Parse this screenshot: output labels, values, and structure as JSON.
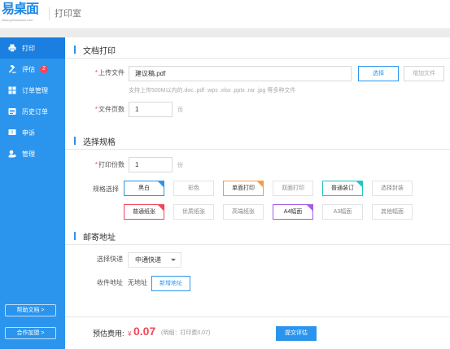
{
  "header": {
    "logo_text": "易桌面",
    "logo_sub": "www.yizhuomian.com",
    "title": "打印室"
  },
  "sidebar": {
    "items": [
      {
        "label": "打印",
        "icon": "printer-icon",
        "active": true
      },
      {
        "label": "评估",
        "icon": "gavel-icon",
        "badge": "2"
      },
      {
        "label": "订单管理",
        "icon": "grid-icon"
      },
      {
        "label": "历史订单",
        "icon": "history-icon"
      },
      {
        "label": "申诉",
        "icon": "flag-icon"
      },
      {
        "label": "管理",
        "icon": "user-gear-icon"
      }
    ],
    "help_label": "帮助文档 >",
    "partner_label": "合作加盟 >"
  },
  "doc_print": {
    "section_title": "文档打印",
    "upload_label": "上传文件",
    "file_name": "建议稿.pdf",
    "select_button": "选择",
    "add_file_button": "增加文件",
    "hint": "支持上传500M以内的.doc .pdf .wps .xlsx .pptx .rar .jpg 等多种文件",
    "pages_label": "文件页数",
    "pages_value": "1",
    "pages_unit": "页"
  },
  "spec": {
    "section_title": "选择规格",
    "copies_label": "打印份数",
    "copies_value": "1",
    "copies_unit": "份",
    "options_label": "规格选择",
    "options": [
      {
        "label": "黑白",
        "selected": true,
        "corner_color": "#2b95ee"
      },
      {
        "label": "彩色"
      },
      {
        "label": "单面打印",
        "selected": true,
        "corner_color": "#f59a4a"
      },
      {
        "label": "双面打印"
      },
      {
        "label": "普通装订",
        "selected": true,
        "corner_color": "#22c5c5"
      },
      {
        "label": "选择封装"
      },
      {
        "label": "普通纸张",
        "selected": true,
        "corner_color": "#f5455a"
      },
      {
        "label": "优质纸张"
      },
      {
        "label": "高端纸张"
      },
      {
        "label": "A4幅面",
        "selected": true,
        "corner_color": "#a25ce6"
      },
      {
        "label": "A3幅面"
      },
      {
        "label": "其他幅面"
      }
    ]
  },
  "mail": {
    "section_title": "邮寄地址",
    "express_label": "选择快递",
    "express_value": "中通快递",
    "address_label": "收件地址",
    "address_value": "无地址",
    "new_address_button": "新增地址"
  },
  "footer": {
    "fee_label": "预估费用:",
    "currency": "¥",
    "amount": "0.07",
    "detail": "(明细：打印费0.07)",
    "submit_button": "提交评估"
  }
}
